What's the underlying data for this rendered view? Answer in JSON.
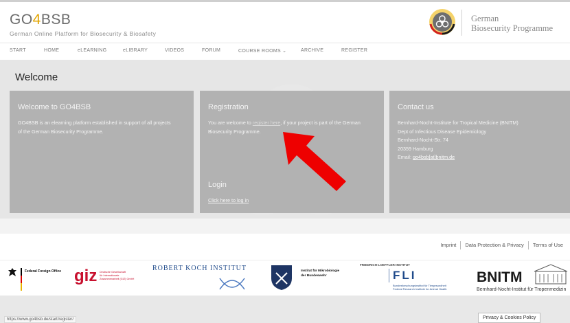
{
  "header": {
    "brand_go": "GO",
    "brand_4": "4",
    "brand_bsb": "BSB",
    "brand_subtitle": "German Online Platform for Biosecurity & Biosafety",
    "programme_line1": "German",
    "programme_line2": "Biosecurity Programme"
  },
  "nav": {
    "items": [
      "START",
      "HOME",
      "eLEARNING",
      "eLIBRARY",
      "VIDEOS",
      "FORUM",
      "COURSE ROOMS ⌄",
      "ARCHIVE",
      "REGISTER"
    ]
  },
  "main": {
    "welcome_title": "Welcome",
    "panel_about": {
      "title": "Welcome to GO4BSB",
      "body_line1": "GO4BSB is an elearning platform established in support of all projects",
      "body_line2": "of the German Biosecurity Programme."
    },
    "panel_registration": {
      "title": "Registration",
      "body_pre": "You are welcome to ",
      "body_link": "register here",
      "body_post": ", if your project is part of the German",
      "body_line2": "Biosecurity Programme.",
      "login_title": "Login",
      "login_link": "Click here to log in"
    },
    "panel_contact": {
      "title": "Contact us",
      "line1": "Bernhard-Nocht-Institute for Tropical Medicine (BNITM)",
      "line2": "Dept of Infectious Disease Epidemiology",
      "line3": "Bernhard-Nocht-Str. 74",
      "line4": "20359 Hamburg",
      "email_label": "Email: ",
      "email": "go4bsb[at]bnitm.de"
    }
  },
  "footer": {
    "links": [
      "Imprint",
      "Data Protection & Privacy",
      "Terms of Use"
    ]
  },
  "partners": {
    "ffo": "Federal Foreign Office",
    "giz": "giz",
    "giz_line1": "Deutsche Gesellschaft",
    "giz_line2": "für Internationale",
    "giz_line3": "Zusammenarbeit (GIZ) GmbH",
    "rki": "ROBERT KOCH INSTITUT",
    "imb_line1": "Institut für Mikrobiologie",
    "imb_line2": "der Bundeswehr",
    "fli_top": "FRIEDRICH-LOEFFLER-INSTITUT",
    "fli": "FLI",
    "fli_line1": "Bundesforschungsinstitut für Tiergesundheit",
    "fli_line2": "Federal Research Institute for Animal Health",
    "bnitm": "BNITM",
    "bnitm_sub": "Bernhard-Nocht-Institut für Tropenmedizin"
  },
  "status_bar": {
    "url": "https://www.go4bsb.de/start/register/"
  },
  "cookie_button": "Privacy & Cookies Policy",
  "colors": {
    "brand_accent": "#e2a500",
    "panel": "#b2b2b2",
    "arrow": "#ee0000"
  }
}
